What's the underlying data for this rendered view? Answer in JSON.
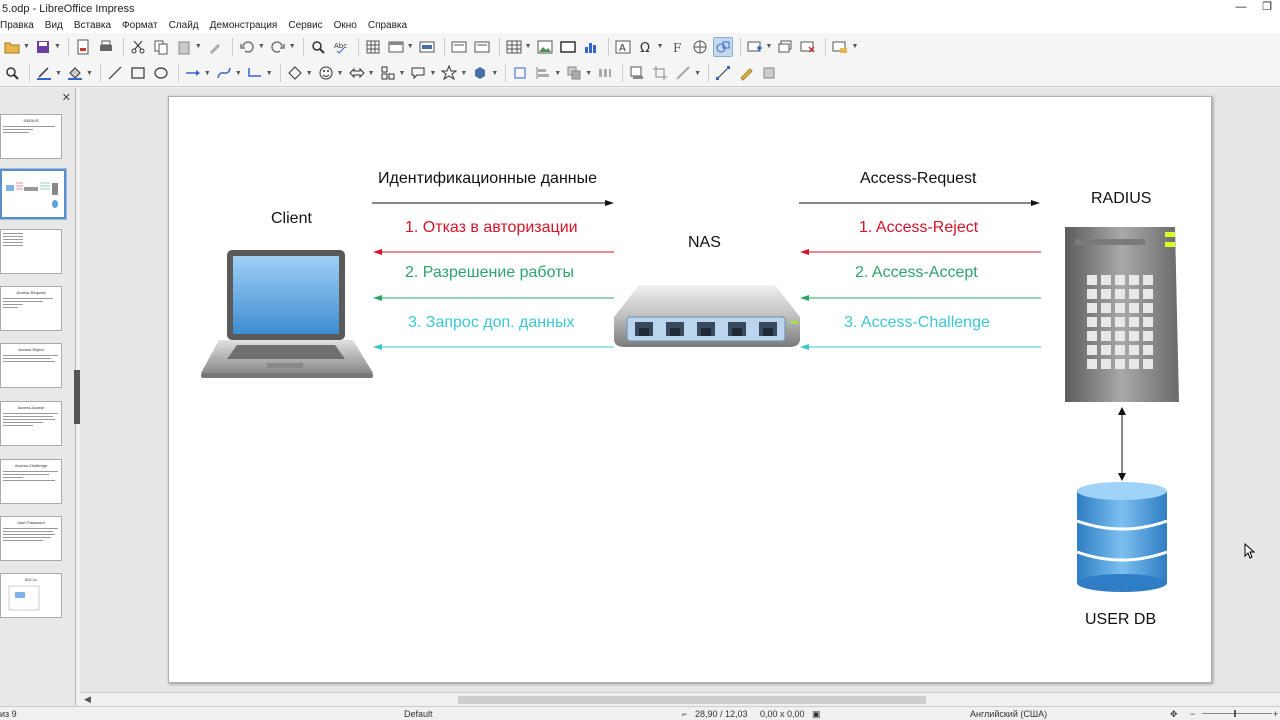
{
  "window": {
    "title": "5.odp - LibreOffice Impress",
    "buttons": [
      "—",
      "❐"
    ]
  },
  "menu": [
    "Правка",
    "Вид",
    "Вставка",
    "Формат",
    "Слайд",
    "Демонстрация",
    "Сервис",
    "Окно",
    "Справка"
  ],
  "slide_panel": {
    "thumbnails": [
      {
        "title": "RADIUS"
      },
      {
        "title": ""
      },
      {
        "title": ""
      },
      {
        "title": "Access-Request"
      },
      {
        "title": "Access-Reject"
      },
      {
        "title": "Access-Accept"
      },
      {
        "title": "Access-Challenge"
      },
      {
        "title": "User-Password"
      },
      {
        "title": "802.1x"
      }
    ]
  },
  "slide": {
    "client_label": "Client",
    "nas_label": "NAS",
    "radius_label": "RADIUS",
    "userdb_label": "USER DB",
    "left": {
      "top_msg": "Идентификационные данные",
      "msg1": "1. Отказ в авторизации",
      "msg2": "2. Разрешение работы",
      "msg3": "3. Запрос доп. данных"
    },
    "right": {
      "top_msg": "Access-Request",
      "msg1": "1. Access-Reject",
      "msg2": "2. Access-Accept",
      "msg3": "3. Access-Challenge"
    },
    "colors": {
      "red": "#d4142a",
      "green": "#2ea36a",
      "cyan": "#3cc7cf"
    }
  },
  "status": {
    "slide_count": "из 9",
    "layout": "Default",
    "position": "28,90 / 12,03",
    "size": "0,00 x 0,00",
    "language": "Английский (США)"
  }
}
